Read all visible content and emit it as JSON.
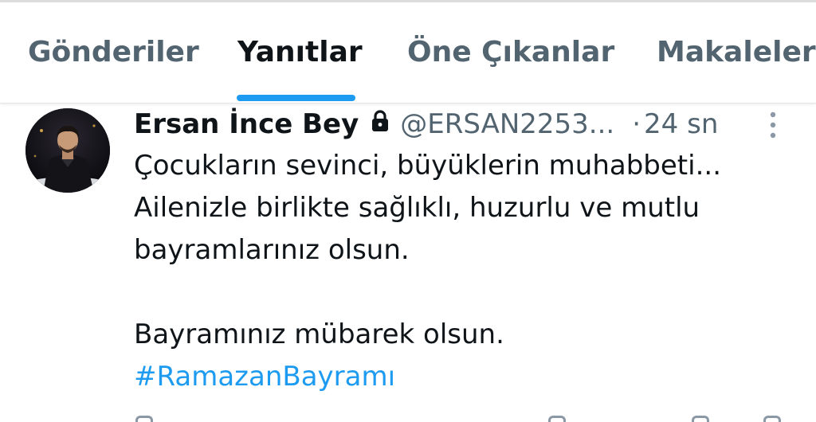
{
  "tabs": [
    {
      "label": "Gönderiler",
      "active": false
    },
    {
      "label": "Yanıtlar",
      "active": true
    },
    {
      "label": "Öne Çıkanlar",
      "active": false
    },
    {
      "label": "Makaleler",
      "active": false
    }
  ],
  "tweet": {
    "display_name": "Ersan İnce Bey",
    "handle": "@ERSAN2253...",
    "separator": "·",
    "time": "24 sn",
    "protected_icon": "lock-icon",
    "lines": [
      "Çocukların sevinci, büyüklerin muhabbeti...",
      "Ailenizle birlikte sağlıklı, huzurlu ve mutlu",
      "bayramlarınız olsun.",
      "",
      "Bayramınız mübarek olsun."
    ],
    "hashtag": "#RamazanBayramı"
  },
  "colors": {
    "accent": "#1d9bf0",
    "text_primary": "#0f1419",
    "text_secondary": "#536471"
  }
}
